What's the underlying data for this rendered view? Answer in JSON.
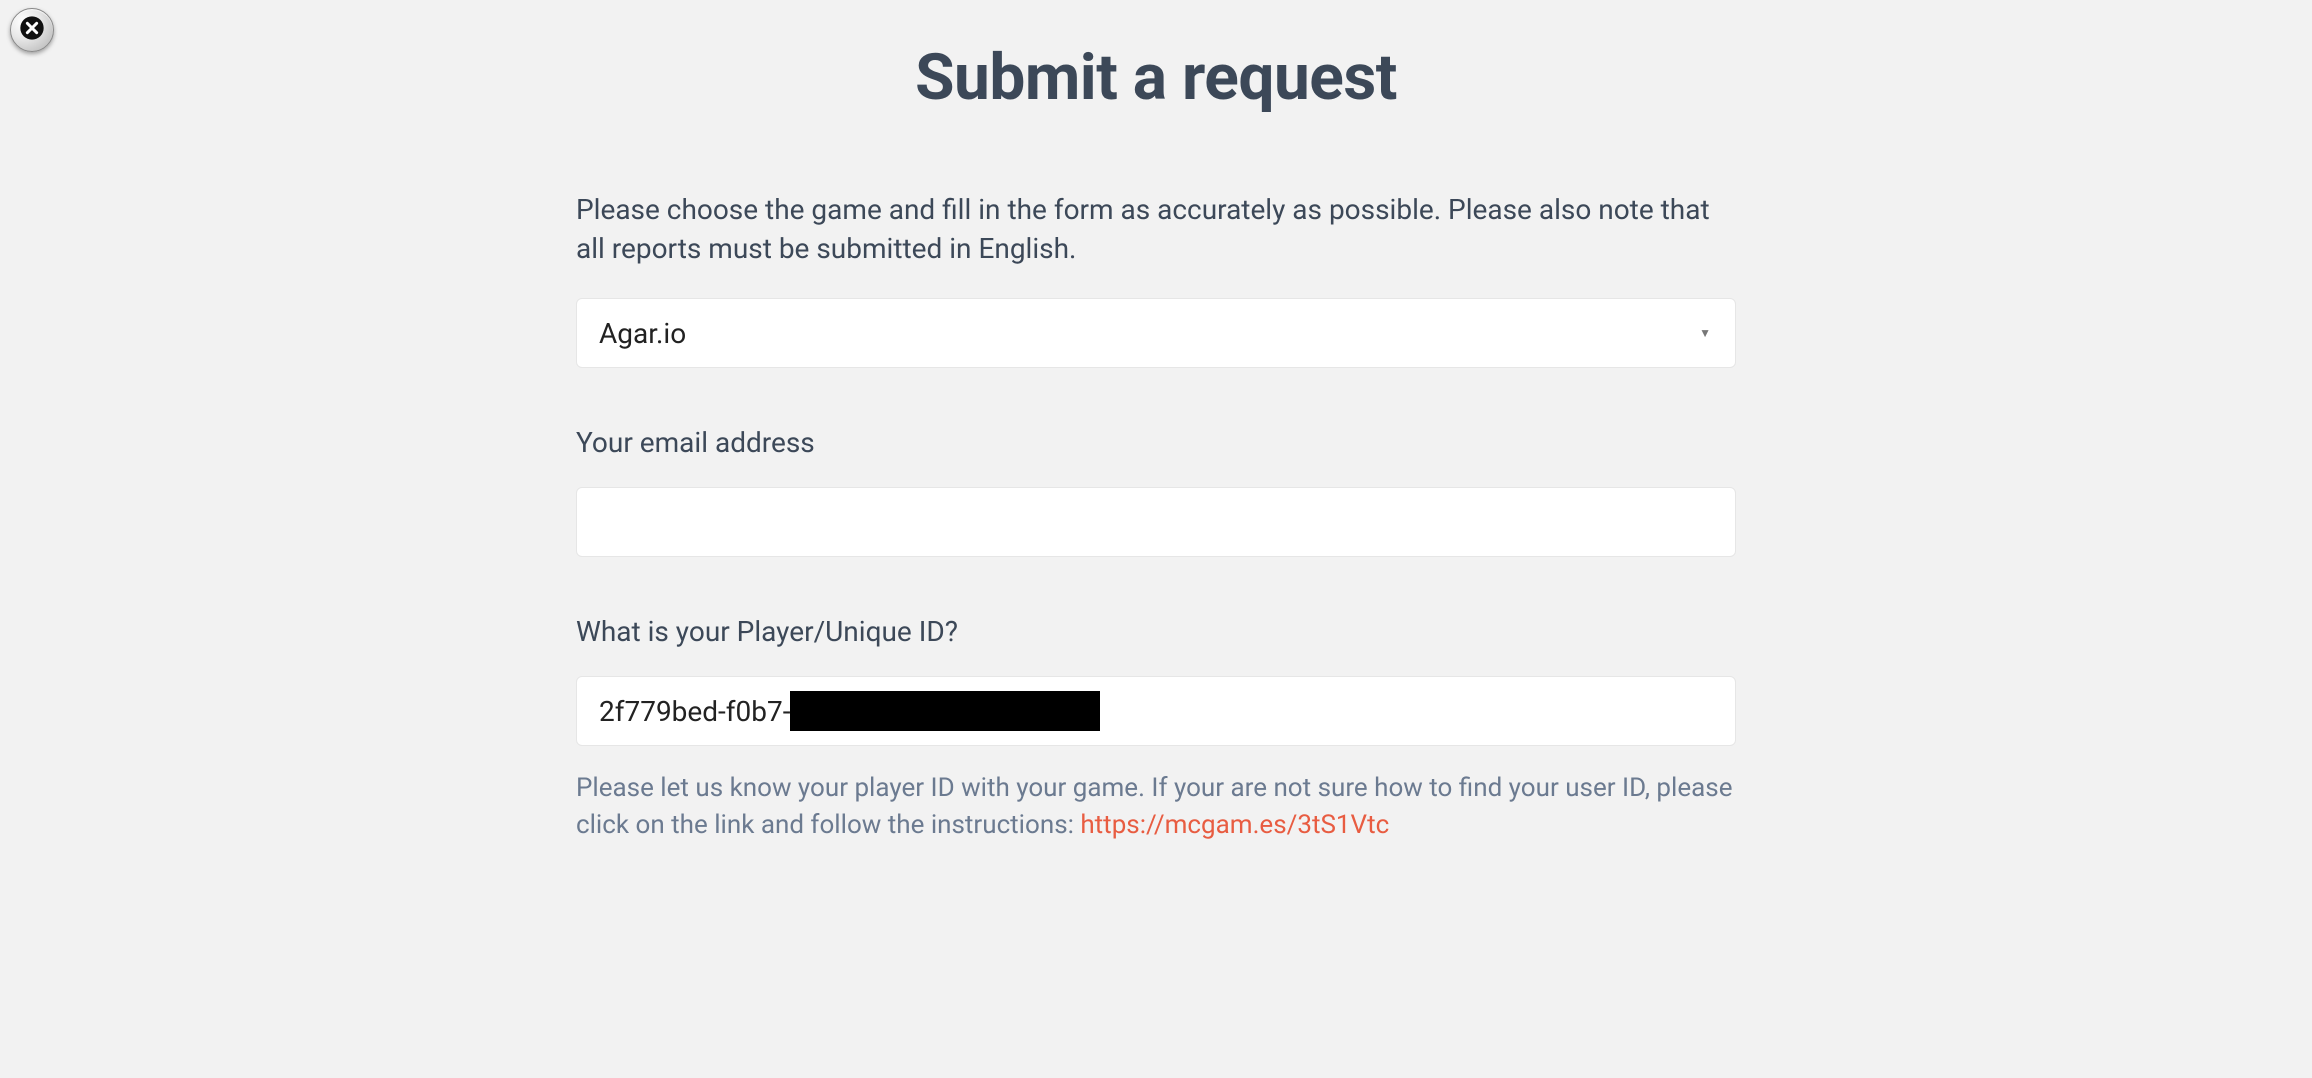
{
  "page": {
    "title": "Submit a request",
    "intro": "Please choose the game and fill in the form as accurately as possible. Please also note that all reports must be submitted in English."
  },
  "form": {
    "game_select": {
      "value": "Agar.io"
    },
    "email": {
      "label": "Your email address",
      "value": ""
    },
    "player_id": {
      "label": "What is your Player/Unique ID?",
      "value_visible": "2f779bed-f0b7-",
      "hint_prefix": "Please let us know your player ID with your game. If your are not sure how to find your user ID, please click on the link and follow the instructions: ",
      "hint_link": "https://mcgam.es/3tS1Vtc"
    }
  }
}
